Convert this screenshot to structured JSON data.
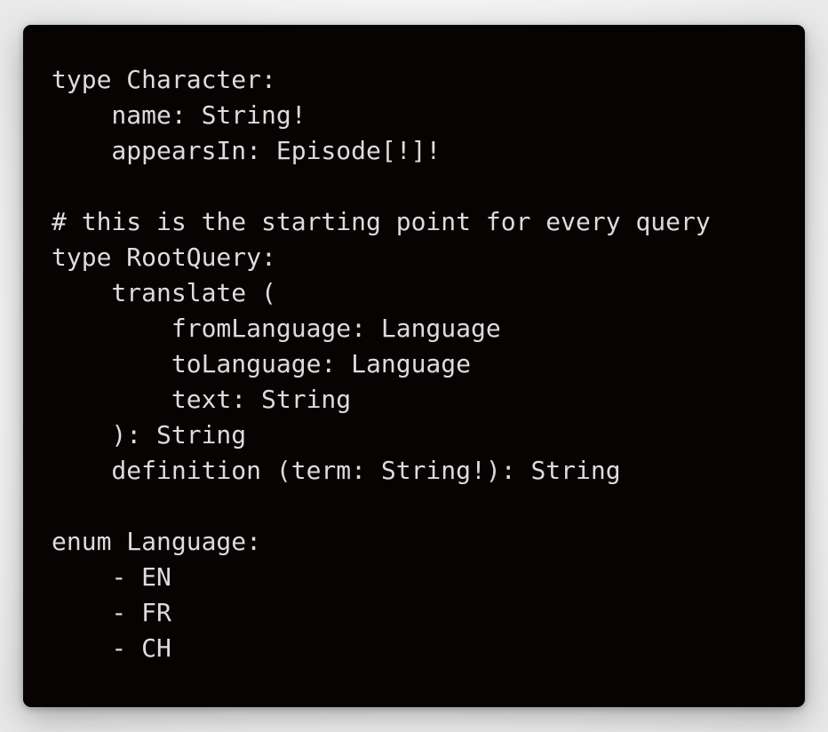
{
  "code": {
    "lines": [
      "type Character:",
      "    name: String!",
      "    appearsIn: Episode[!]!",
      "",
      "# this is the starting point for every query",
      "type RootQuery:",
      "    translate (",
      "        fromLanguage: Language",
      "        toLanguage: Language",
      "        text: String",
      "    ): String",
      "    definition (term: String!): String",
      "",
      "enum Language:",
      "    - EN",
      "    - FR",
      "    - CH"
    ]
  }
}
